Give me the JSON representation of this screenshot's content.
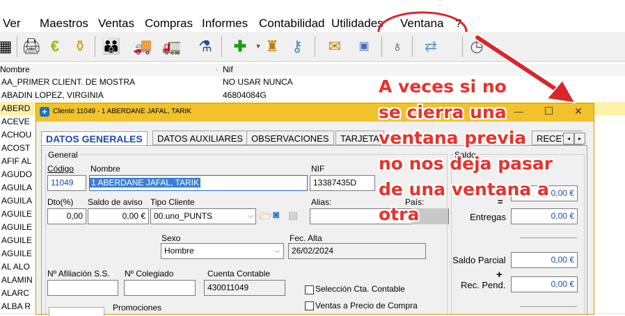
{
  "menu": {
    "items": [
      "Ver",
      "Maestros",
      "Ventas",
      "Compras",
      "Informes",
      "Contabilidad",
      "Utilidades",
      "Ventana",
      "?"
    ]
  },
  "toolbar": {
    "icons": [
      "calculator-icon",
      "printer-icon",
      "euro-icon",
      "bottle-icon",
      "people-icon",
      "truck-icon",
      "truck-small-icon",
      "flask-icon",
      "add-icon",
      "user-key-icon",
      "key-icon",
      "mail-icon",
      "calendar-icon",
      "dropper-icon",
      "arrows-icon",
      "clock-icon"
    ]
  },
  "grid": {
    "headers": [
      "Nombre",
      "Nif"
    ],
    "rows": [
      {
        "name": "AA_PRIMER CLIENT. DE MOSTRA",
        "nif": "NO USAR NUNCA"
      },
      {
        "name": "ABADIN LOPEZ, VIRGINIA",
        "nif": "46804084G"
      },
      {
        "name": "ABERD",
        "nif": ""
      },
      {
        "name": "ACEVE",
        "nif": ""
      },
      {
        "name": "ACHOU",
        "nif": ""
      },
      {
        "name": "ACOST",
        "nif": ""
      },
      {
        "name": "AFIF AL",
        "nif": ""
      },
      {
        "name": "AGUDO",
        "nif": ""
      },
      {
        "name": "AGUILA",
        "nif": ""
      },
      {
        "name": "AGUILA",
        "nif": ""
      },
      {
        "name": "AGUILE",
        "nif": ""
      },
      {
        "name": "AGUILE",
        "nif": ""
      },
      {
        "name": "AGUILE",
        "nif": ""
      },
      {
        "name": "AGUILE",
        "nif": ""
      },
      {
        "name": "AL ALO",
        "nif": ""
      },
      {
        "name": "ALAMIN",
        "nif": ""
      },
      {
        "name": "ALARC",
        "nif": ""
      },
      {
        "name": "ALBA R",
        "nif": ""
      }
    ]
  },
  "dialog": {
    "title": "Cliente  11049 - 1 ABERDANE JAFAL, TARIK",
    "tabs": [
      "DATOS GENERALES",
      "DATOS AUXILIARES",
      "OBSERVACIONES",
      "TARJETA",
      "RECETAS"
    ],
    "general_group": "General",
    "codigo_label": "Código",
    "codigo_value": "11049",
    "nombre_label": "Nombre",
    "nombre_value": "1 ABERDANE JAFAL, TARIK",
    "nif_label": "NIF",
    "nif_value": "13387435D",
    "dto_label": "Dto(%)",
    "dto_value": "0,00",
    "saldo_aviso_label": "Saldo de aviso",
    "saldo_aviso_value": "0,00 €",
    "tipo_cliente_label": "Tipo Cliente",
    "tipo_cliente_value": "00.uno_PUNTS",
    "alias_label": "Alias:",
    "pais_label": "País:",
    "sexo_label": "Sexo",
    "sexo_value": "Hombre",
    "fec_alta_label": "Fec. Alta",
    "fec_alta_value": "26/02/2024",
    "afiliacion_label": "Nº Afiliación S.S.",
    "colegiado_label": "Nº Colegiado",
    "cuenta_label": "Cuenta Contable",
    "cuenta_value": "430011049",
    "seleccion_label": "Selección Cta. Contable",
    "ventas_precio_label": "Ventas a Precio de Compra",
    "promociones_label": "Promociones",
    "saldo_group": "Saldo",
    "saldo_top_value": "0,00 €",
    "entregas_label": "Entregas",
    "entregas_value": "0,00 €",
    "saldo_parcial_label": "Saldo Parcial",
    "saldo_parcial_value": "0,00 €",
    "rec_pend_label": "Rec. Pend.",
    "rec_pend_value": "0,00 €",
    "minus_sign": "=",
    "plus_sign": "+",
    "min_glyph": "—",
    "max_glyph": "☐",
    "close_glyph": "✕"
  },
  "annotation": {
    "lines": [
      "A veces si no",
      "se cierra una",
      "ventana previa",
      "no nos deja pasar",
      "de una ventana a",
      "otra"
    ],
    "color": "#e8322c"
  },
  "colors": {
    "title_bar": "#f2c22c",
    "selection": "#3b7fd4",
    "selected_row": "#fff2a8"
  }
}
